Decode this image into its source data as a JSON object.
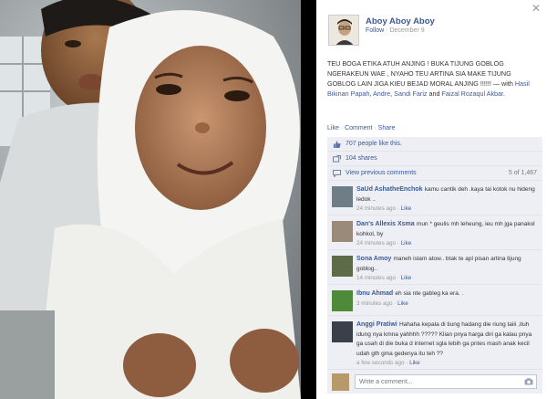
{
  "post": {
    "author": "Aboy Aboy Aboy",
    "follow_label": "Follow",
    "dot": " · ",
    "date": "December 9",
    "close_label": "✕",
    "caption_text": "TEU BOGA ETIKA ATUH ANJING ! BUKA TIJUNG GOBLOG NGERAKEUN WAE , NYAHO TEU ARTINA SIA MAKE TIJUNG GOBLOG LAIN JIGA KIEU BEJAD MORAL ANJING !!!!!! — with ",
    "tag_1": "Hasil Bikinan Papah",
    "tag_2": "Andre",
    "tag_3": "Sandi Fariz",
    "and_word": " and ",
    "tag_4": "Faizal Rozaqul Akbar",
    "period": ".",
    "comma": ", "
  },
  "actions": {
    "like": "Like",
    "comment": "Comment",
    "share": "Share",
    "sep": " · "
  },
  "feedback": {
    "likes": "707 people like this.",
    "shares": "104 shares",
    "view_previous": "View previous comments",
    "count": "5 of 1,467"
  },
  "comments": [
    {
      "name": "SaUd AshatheEnchok",
      "text": "kamu cantik deh .kaya tai kotok nu hideng ledok ..",
      "time": "24 minutes ago",
      "like": "Like"
    },
    {
      "name": "Dan's Allexis Xsma",
      "text": "mun * geulis mh leheung, ieu mh jga panakol kohkol, by",
      "time": "24 minutes ago",
      "like": "Like"
    },
    {
      "name": "Sona Amoy",
      "text": "maneh islam atow.. btak te apl pisan artina tijung goblog..",
      "time": "14 minutes ago",
      "like": "Like"
    },
    {
      "name": "Ibnu Ahmad",
      "text": "eh sia nte gableg ka era. .",
      "time": "3 minutes ago",
      "like": "Like"
    },
    {
      "name": "Anggi Pratiwi",
      "text": "Hahaha kepala di tiung hadang die riung taiii ,ituh idung nya kmna yahhhh ????? Klian pnya harga diri ga kalau pnya ga usah di die buka d internet sgla lebih ga pntes mash anak kecil udah gth gma gedenya itu teh ??",
      "time": "a few seconds ago",
      "like": "Like"
    }
  ],
  "write_comment": {
    "placeholder": "Write a comment..."
  },
  "colors": {
    "link": "#3b5998",
    "panel": "#edeff4"
  }
}
